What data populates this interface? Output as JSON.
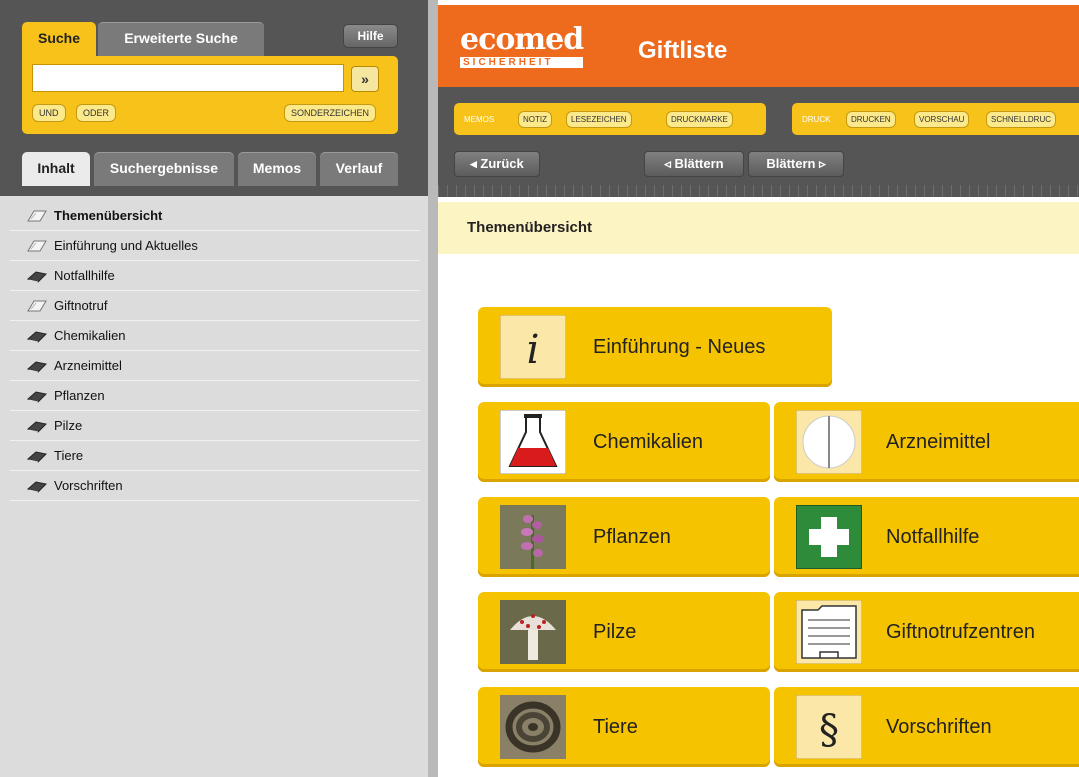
{
  "search": {
    "tab_simple": "Suche",
    "tab_advanced": "Erweiterte Suche",
    "help": "Hilfe",
    "input_value": "",
    "go_symbol": "»",
    "btn_and": "UND",
    "btn_or": "ODER",
    "btn_special": "SONDERZEICHEN"
  },
  "sidebar_tabs": [
    "Inhalt",
    "Suchergebnisse",
    "Memos",
    "Verlauf"
  ],
  "nav": {
    "items": [
      {
        "label": "Themenübersicht",
        "icon": "book-open-icon"
      },
      {
        "label": "Einführung und Aktuelles",
        "icon": "book-open-icon"
      },
      {
        "label": "Notfallhilfe",
        "icon": "book-closed-icon"
      },
      {
        "label": "Giftnotruf",
        "icon": "book-open-icon"
      },
      {
        "label": "Chemikalien",
        "icon": "book-closed-icon"
      },
      {
        "label": "Arzneimittel",
        "icon": "book-closed-icon"
      },
      {
        "label": "Pflanzen",
        "icon": "book-closed-icon"
      },
      {
        "label": "Pilze",
        "icon": "book-closed-icon"
      },
      {
        "label": "Tiere",
        "icon": "book-closed-icon"
      },
      {
        "label": "Vorschriften",
        "icon": "book-closed-icon"
      }
    ]
  },
  "header": {
    "logo": "ecomed",
    "logo_sub": "SICHERHEIT",
    "title": "Giftliste"
  },
  "toolbar": {
    "memos_label": "MEMOS",
    "memos_buttons": [
      "NOTIZ",
      "LESEZEICHEN",
      "DRUCKMARKE"
    ],
    "print_label": "DRUCK",
    "print_buttons": [
      "DRUCKEN",
      "VORSCHAU",
      "SCHNELLDRUC"
    ],
    "back": "◂ Zurück",
    "page_prev": "◃ Blättern",
    "page_next": "Blättern ▹"
  },
  "breadcrumb": "Themenübersicht",
  "tiles": {
    "intro": "Einführung - Neues",
    "chem": "Chemikalien",
    "drug": "Arzneimittel",
    "plant": "Pflanzen",
    "aid": "Notfallhilfe",
    "fungi": "Pilze",
    "centers": "Giftnotrufzentren",
    "animals": "Tiere",
    "rules": "Vorschriften"
  },
  "icon_glyphs": {
    "info": "i",
    "section": "§"
  },
  "colors": {
    "accent_orange": "#ee6a1c",
    "tile_yellow": "#f6c300",
    "panel_gray": "#555555"
  }
}
